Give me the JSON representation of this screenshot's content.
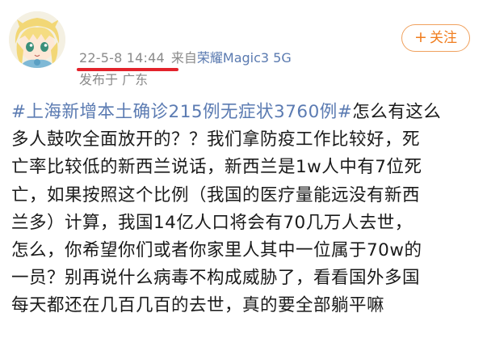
{
  "post": {
    "timestamp": "22-5-8 14:44",
    "source_prefix": "来自",
    "device": "荣耀Magic3 5G",
    "location": "发布于 广东",
    "follow_button": {
      "icon": "plus-icon",
      "label": "关注"
    },
    "topic": "#上海新增本土确诊215例无症状3760例#",
    "body_lines": [
      "怎么有这么",
      "多人鼓吹全面放开的？？我们拿防疫工作比较好，死",
      "亡率比较低的新西兰说话，新西兰是1w人中有7位死",
      "亡，如果按照这个比例（我国的医疗量能远没有新西",
      "兰多）计算，我国14亿人口将会有70几万人去世，",
      "怎么，你希望你们或者你家里人其中一位属于70w的",
      "一员？别再说什么病毒不构成威胁了，看看国外多国",
      "每天都还在几百几百的去世，真的要全部躺平嘛"
    ]
  },
  "colors": {
    "topic_blue": "#5b7bb2",
    "follow_orange": "#f07d1e",
    "annotation_red": "#e3232b",
    "meta_gray": "#8a8a8a"
  }
}
